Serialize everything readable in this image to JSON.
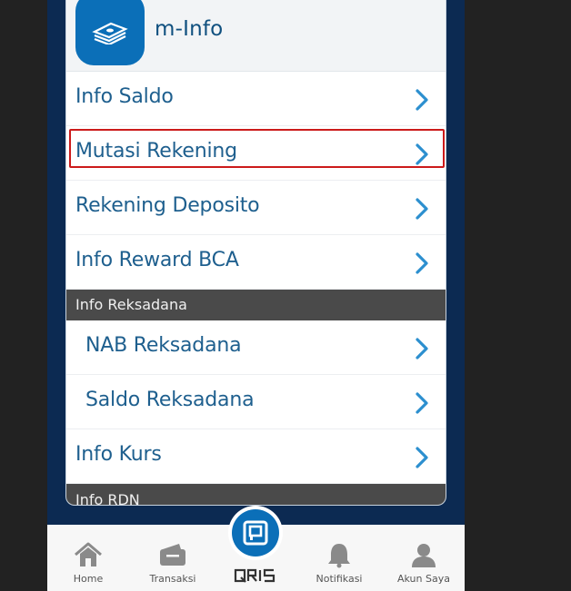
{
  "header": {
    "title": "m-Info",
    "icon": "money-stack-icon"
  },
  "menu": [
    {
      "label": "Info Saldo",
      "type": "item"
    },
    {
      "label": "Mutasi Rekening",
      "type": "item",
      "highlighted": true
    },
    {
      "label": "Rekening Deposito",
      "type": "item"
    },
    {
      "label": "Info Reward BCA",
      "type": "item"
    },
    {
      "label": "Info Reksadana",
      "type": "section"
    },
    {
      "label": "NAB Reksadana",
      "type": "subitem"
    },
    {
      "label": "Saldo Reksadana",
      "type": "subitem"
    },
    {
      "label": "Info Kurs",
      "type": "item"
    },
    {
      "label": "Info RDN",
      "type": "section"
    }
  ],
  "bottom_nav": [
    {
      "label": "Home",
      "icon": "home-icon"
    },
    {
      "label": "Transaksi",
      "icon": "wallet-icon"
    },
    {
      "label": "",
      "icon": "qris-icon"
    },
    {
      "label": "Notifikasi",
      "icon": "bell-icon"
    },
    {
      "label": "Akun Saya",
      "icon": "user-icon"
    }
  ],
  "colors": {
    "brand": "#0b6fb8",
    "text": "#1e5f8e",
    "highlight": "#cc1a1a",
    "section": "#4a4a4a"
  }
}
